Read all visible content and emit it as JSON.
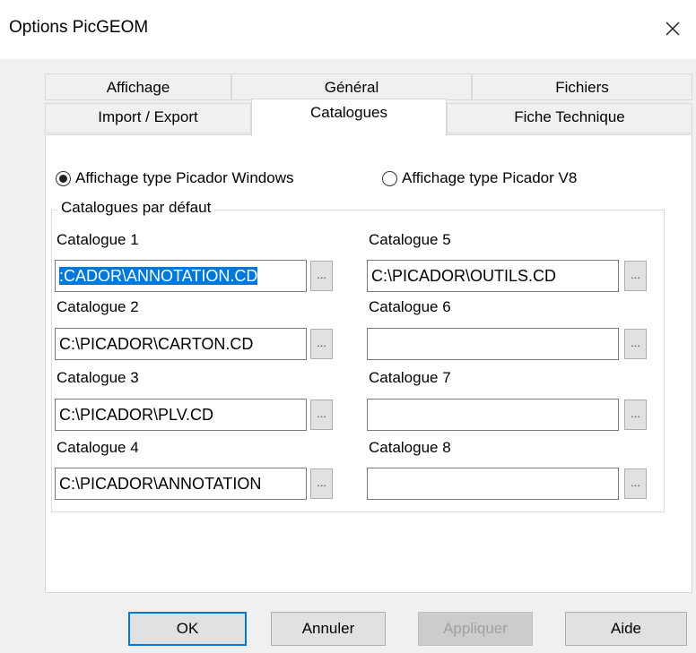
{
  "window": {
    "title": "Options PicGEOM",
    "close_icon": "close-icon"
  },
  "tabs": {
    "row1": [
      {
        "label": "Affichage"
      },
      {
        "label": "Général"
      },
      {
        "label": "Fichiers"
      }
    ],
    "row2": [
      {
        "label": "Import / Export"
      },
      {
        "label": "Catalogues",
        "active": true
      },
      {
        "label": "Fiche Technique"
      }
    ]
  },
  "display_mode": {
    "options": [
      {
        "label": "Affichage type Picador Windows",
        "checked": true
      },
      {
        "label": "Affichage type Picador V8",
        "checked": false
      }
    ]
  },
  "catalogues": {
    "group_label": "Catalogues par défaut",
    "browse_label": "...",
    "items": [
      {
        "label": "Catalogue 1",
        "value": ":CADOR\\ANNOTATION.CD",
        "selected": true
      },
      {
        "label": "Catalogue 2",
        "value": "C:\\PICADOR\\CARTON.CD"
      },
      {
        "label": "Catalogue 3",
        "value": "C:\\PICADOR\\PLV.CD"
      },
      {
        "label": "Catalogue 4",
        "value": "C:\\PICADOR\\ANNOTATION"
      },
      {
        "label": "Catalogue 5",
        "value": "C:\\PICADOR\\OUTILS.CD"
      },
      {
        "label": "Catalogue 6",
        "value": ""
      },
      {
        "label": "Catalogue 7",
        "value": ""
      },
      {
        "label": "Catalogue 8",
        "value": ""
      }
    ]
  },
  "buttons": {
    "ok": "OK",
    "cancel": "Annuler",
    "apply": "Appliquer",
    "help": "Aide"
  }
}
